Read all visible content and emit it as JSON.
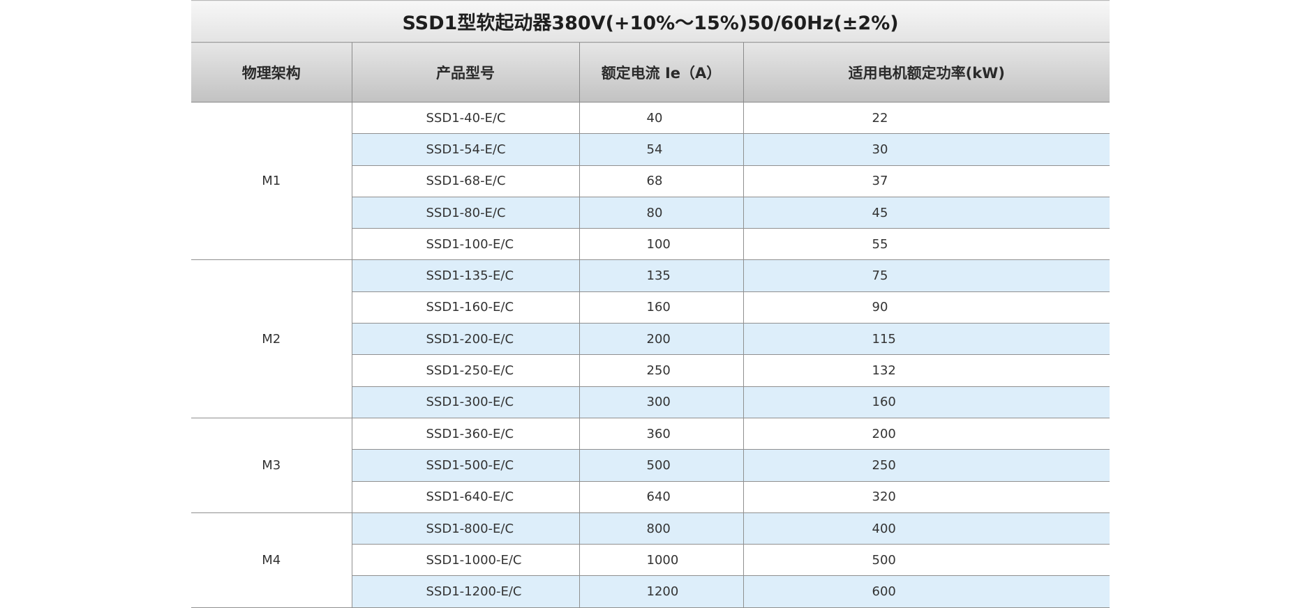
{
  "table": {
    "title": "SSD1型软起动器380V(+10%～15%)50/60Hz(±2%)",
    "headers": [
      "物理架构",
      "产品型号",
      "额定电流 Ie（A）",
      "适用电机额定功率(kW)"
    ],
    "groups": [
      {
        "frame": "M1",
        "rows": [
          {
            "model": "SSD1-40-E/C",
            "current": "40",
            "power": "22"
          },
          {
            "model": "SSD1-54-E/C",
            "current": "54",
            "power": "30"
          },
          {
            "model": "SSD1-68-E/C",
            "current": "68",
            "power": "37"
          },
          {
            "model": "SSD1-80-E/C",
            "current": "80",
            "power": "45"
          },
          {
            "model": "SSD1-100-E/C",
            "current": "100",
            "power": "55"
          }
        ]
      },
      {
        "frame": "M2",
        "rows": [
          {
            "model": "SSD1-135-E/C",
            "current": "135",
            "power": "75"
          },
          {
            "model": "SSD1-160-E/C",
            "current": "160",
            "power": "90"
          },
          {
            "model": "SSD1-200-E/C",
            "current": "200",
            "power": "115"
          },
          {
            "model": "SSD1-250-E/C",
            "current": "250",
            "power": "132"
          },
          {
            "model": "SSD1-300-E/C",
            "current": "300",
            "power": "160"
          }
        ]
      },
      {
        "frame": "M3",
        "rows": [
          {
            "model": "SSD1-360-E/C",
            "current": "360",
            "power": "200"
          },
          {
            "model": "SSD1-500-E/C",
            "current": "500",
            "power": "250"
          },
          {
            "model": "SSD1-640-E/C",
            "current": "640",
            "power": "320"
          }
        ]
      },
      {
        "frame": "M4",
        "rows": [
          {
            "model": "SSD1-800-E/C",
            "current": "800",
            "power": "400"
          },
          {
            "model": "SSD1-1000-E/C",
            "current": "1000",
            "power": "500"
          },
          {
            "model": "SSD1-1200-E/C",
            "current": "1200",
            "power": "600"
          }
        ]
      }
    ]
  },
  "colors": {
    "shaded_row": "#ddeefa",
    "plain_row": "#ffffff",
    "grid_line": "#8f8f8f",
    "header_gradient_top": "#e6e6e6",
    "header_gradient_bottom": "#c2c2c2"
  }
}
